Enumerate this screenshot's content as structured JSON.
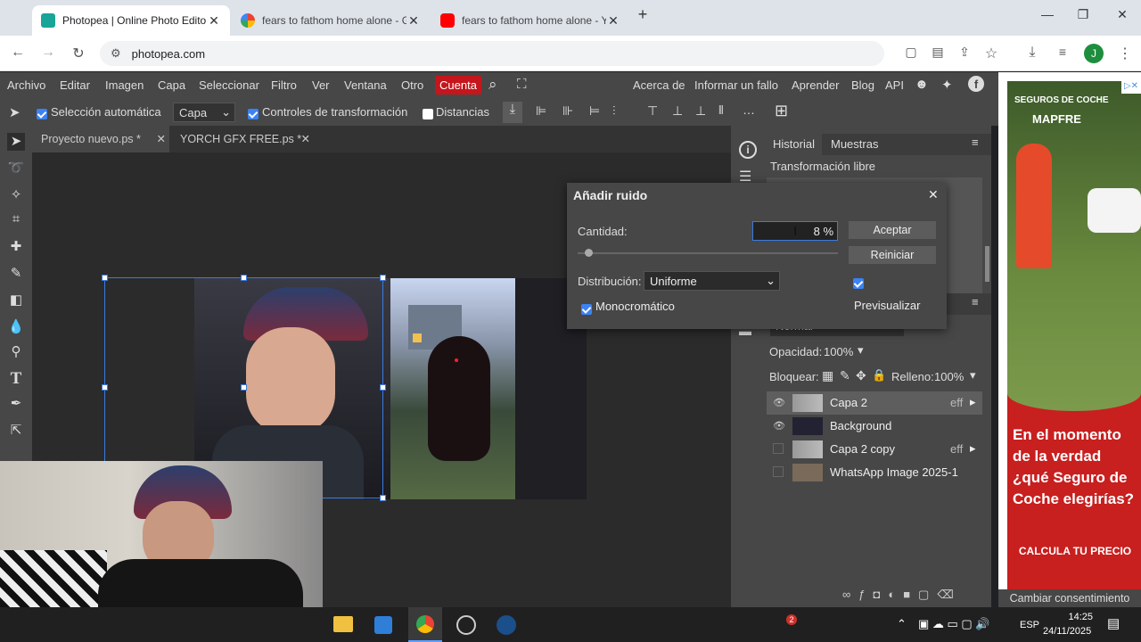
{
  "browser": {
    "tabs": [
      {
        "title": "Photopea | Online Photo Editor",
        "active": true,
        "favicon": "photopea-icon"
      },
      {
        "title": "fears to fathom home alone - G",
        "active": false,
        "favicon": "google-icon"
      },
      {
        "title": "fears to fathom home alone - Y",
        "active": false,
        "favicon": "youtube-icon"
      }
    ],
    "url": "photopea.com",
    "profile_initial": "J"
  },
  "menubar": {
    "items": [
      "Archivo",
      "Editar",
      "Imagen",
      "Capa",
      "Seleccionar",
      "Filtro",
      "Ver",
      "Ventana",
      "Otro"
    ],
    "account": "Cuenta",
    "right_items": [
      "Acerca de",
      "Informar un fallo",
      "Aprender",
      "Blog",
      "API"
    ]
  },
  "options": {
    "auto_select_label": "Selección automática",
    "layer_select": "Capa",
    "transform_controls_label": "Controles de transformación",
    "distances_label": "Distancias"
  },
  "documents": {
    "tabs": [
      {
        "title": "Proyecto nuevo.ps *",
        "active": true
      },
      {
        "title": "YORCH GFX FREE.ps *",
        "active": false
      }
    ]
  },
  "history_panel": {
    "tabs": [
      "Historial",
      "Muestras"
    ],
    "entries": [
      "Transformación libre"
    ]
  },
  "layers_panel": {
    "blend_mode": "Normal",
    "opacity_label": "Opacidad:",
    "opacity_value": "100%",
    "lock_label": "Bloquear:",
    "fill_label": "Relleno:",
    "fill_value": "100%",
    "layers": [
      {
        "name": "Capa 2",
        "visible": true,
        "fx": "eff",
        "selected": true
      },
      {
        "name": "Background",
        "visible": true,
        "fx": "",
        "selected": false
      },
      {
        "name": "Capa 2 copy",
        "visible": false,
        "fx": "eff",
        "selected": false
      },
      {
        "name": "WhatsApp Image 2025-1",
        "visible": false,
        "fx": "",
        "selected": false
      }
    ]
  },
  "dialog": {
    "title": "Añadir ruido",
    "amount_label": "Cantidad:",
    "amount_value": "8",
    "amount_unit": "%",
    "amount_slider_fraction": 0.04,
    "distribution_label": "Distribución:",
    "distribution_value": "Uniforme",
    "mono_label": "Monocromático",
    "accept_label": "Aceptar",
    "reset_label": "Reiniciar",
    "preview_label": "Previsualizar"
  },
  "ad": {
    "brand_line1": "SEGUROS DE COCHE",
    "brand_line2": "MAPFRE",
    "headline": "En el momento de la verdad ¿qué Seguro de Coche elegirías?",
    "cta": "CALCULA TU PRECIO",
    "consent": "Cambiar consentimiento"
  },
  "taskbar": {
    "notification_count": "2",
    "language": "ESP",
    "time": "14:25",
    "date": "24/11/2025"
  },
  "colors": {
    "accent": "#c4161c",
    "panel": "#474747",
    "workspace": "#2b2b2b",
    "checkbox": "#3b82f6"
  }
}
